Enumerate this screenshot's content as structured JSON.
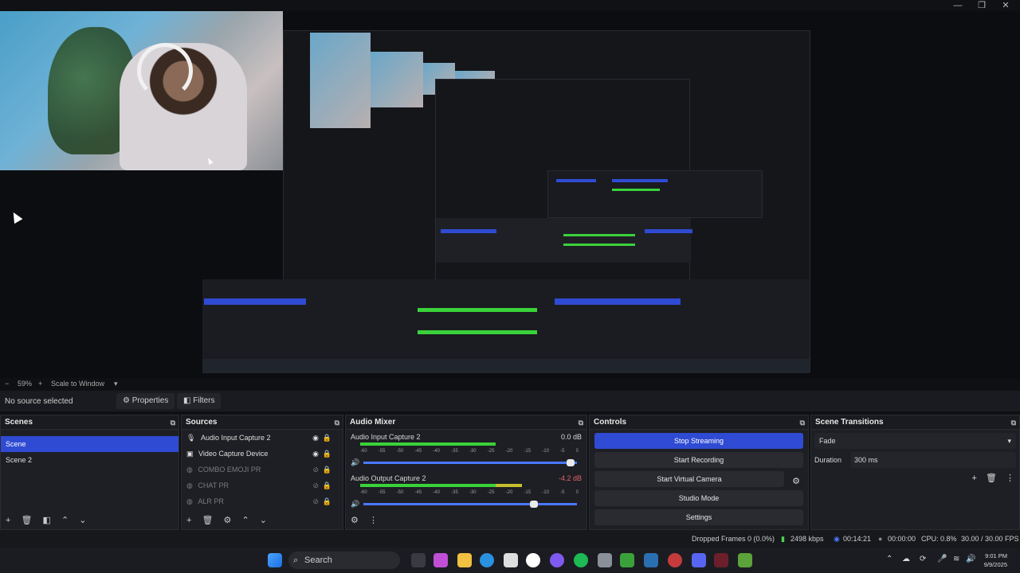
{
  "window": {
    "minimize": "—",
    "maximize": "❐",
    "close": "✕"
  },
  "preview": {
    "zoom": "59%",
    "scale_mode": "Scale to Window"
  },
  "source_bar": {
    "status": "No source selected",
    "properties_label": "Properties",
    "filters_label": "Filters"
  },
  "scenes": {
    "title": "Scenes",
    "items": [
      {
        "label": "Scene",
        "selected": true
      },
      {
        "label": "Scene 2",
        "selected": false
      }
    ]
  },
  "sources": {
    "title": "Sources",
    "items": [
      {
        "label": "Audio Input Capture 2",
        "icon": "microphone-icon",
        "visible": true
      },
      {
        "label": "Video Capture Device",
        "icon": "camera-icon",
        "visible": true
      },
      {
        "label": "COMBO EMOJI PR",
        "icon": "globe-icon",
        "visible": false
      },
      {
        "label": "CHAT PR",
        "icon": "globe-icon",
        "visible": false
      },
      {
        "label": "ALR PR",
        "icon": "globe-icon",
        "visible": false
      }
    ]
  },
  "audio_mixer": {
    "title": "Audio Mixer",
    "tracks": [
      {
        "name": "Audio Input Capture 2",
        "db": "0.0 dB",
        "level": 0.62,
        "volume": 0.98
      },
      {
        "name": "Audio Output Capture 2",
        "db": "-4.2 dB",
        "level": 0.74,
        "volume": 0.81
      }
    ],
    "ticks": [
      "-60",
      "-55",
      "-50",
      "-45",
      "-40",
      "-35",
      "-30",
      "-25",
      "-20",
      "-15",
      "-10",
      "-5",
      "0"
    ]
  },
  "controls": {
    "title": "Controls",
    "stop_streaming": "Stop Streaming",
    "start_recording": "Start Recording",
    "start_virtual_camera": "Start Virtual Camera",
    "studio_mode": "Studio Mode",
    "settings": "Settings"
  },
  "transitions": {
    "title": "Scene Transitions",
    "selected": "Fade",
    "duration_label": "Duration",
    "duration_value": "300 ms"
  },
  "status": {
    "dropped_frames": "Dropped Frames 0 (0.0%)",
    "bitrate": "2498 kbps",
    "stream_time": "00:14:21",
    "rec_time": "00:00:00",
    "cpu": "CPU: 0.8%",
    "fps": "30.00 / 30.00 FPS"
  },
  "taskbar": {
    "search_label": "Search",
    "time": "9:01 PM",
    "date": "9/9/2025"
  },
  "colors": {
    "accent": "#2f4bd3",
    "meter_green": "#3ad23a",
    "meter_yellow": "#c7c02e",
    "meter_red": "#c53b3b"
  }
}
